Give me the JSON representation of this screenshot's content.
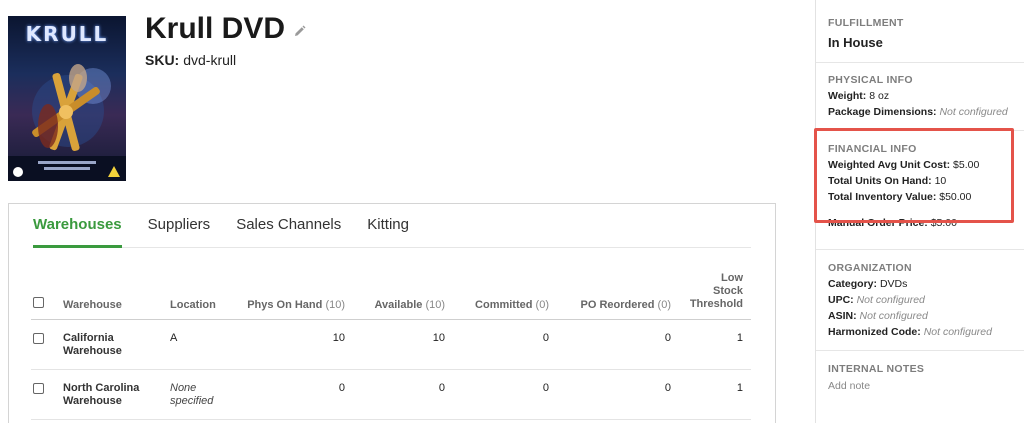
{
  "product": {
    "cover_text": "KRULL",
    "title": "Krull DVD",
    "sku_label": "SKU:",
    "sku_value": "dvd-krull"
  },
  "tabs": [
    {
      "label": "Warehouses",
      "active": true
    },
    {
      "label": "Suppliers",
      "active": false
    },
    {
      "label": "Sales Channels",
      "active": false
    },
    {
      "label": "Kitting",
      "active": false
    }
  ],
  "table": {
    "headers": {
      "warehouse": "Warehouse",
      "location": "Location",
      "phys_label": "Phys On Hand",
      "phys_count": "(10)",
      "avail_label": "Available",
      "avail_count": "(10)",
      "committed_label": "Committed",
      "committed_count": "(0)",
      "po_label": "PO Reordered",
      "po_count": "(0)",
      "low_line1": "Low",
      "low_line2": "Stock",
      "low_line3": "Threshold"
    },
    "rows": [
      {
        "warehouse_l1": "California",
        "warehouse_l2": "Warehouse",
        "location_l1": "A",
        "location_l2": "",
        "phys": "10",
        "available": "10",
        "committed": "0",
        "po": "0",
        "low": "1"
      },
      {
        "warehouse_l1": "North Carolina",
        "warehouse_l2": "Warehouse",
        "location_l1": "None",
        "location_l2": "specified",
        "phys": "0",
        "available": "0",
        "committed": "0",
        "po": "0",
        "low": "1"
      }
    ]
  },
  "sidebar": {
    "fulfillment": {
      "title": "FULFILLMENT",
      "value": "In House"
    },
    "physical": {
      "title": "PHYSICAL INFO",
      "weight_label": "Weight:",
      "weight_value": "8 oz",
      "dims_label": "Package Dimensions:",
      "dims_value": "Not configured"
    },
    "financial": {
      "title": "FINANCIAL INFO",
      "avg_label": "Weighted Avg Unit Cost:",
      "avg_value": "$5.00",
      "units_label": "Total Units On Hand:",
      "units_value": "10",
      "value_label": "Total Inventory Value:",
      "value_value": "$50.00",
      "manual_label": "Manual Order Price:",
      "manual_value": "$5.00"
    },
    "organization": {
      "title": "ORGANIZATION",
      "category_label": "Category:",
      "category_value": "DVDs",
      "upc_label": "UPC:",
      "upc_value": "Not configured",
      "asin_label": "ASIN:",
      "asin_value": "Not configured",
      "hs_label": "Harmonized Code:",
      "hs_value": "Not configured"
    },
    "notes": {
      "title": "INTERNAL NOTES",
      "add_label": "Add note"
    }
  },
  "colors": {
    "accent_green": "#3a9a3e",
    "highlight_red": "#e4534a"
  }
}
